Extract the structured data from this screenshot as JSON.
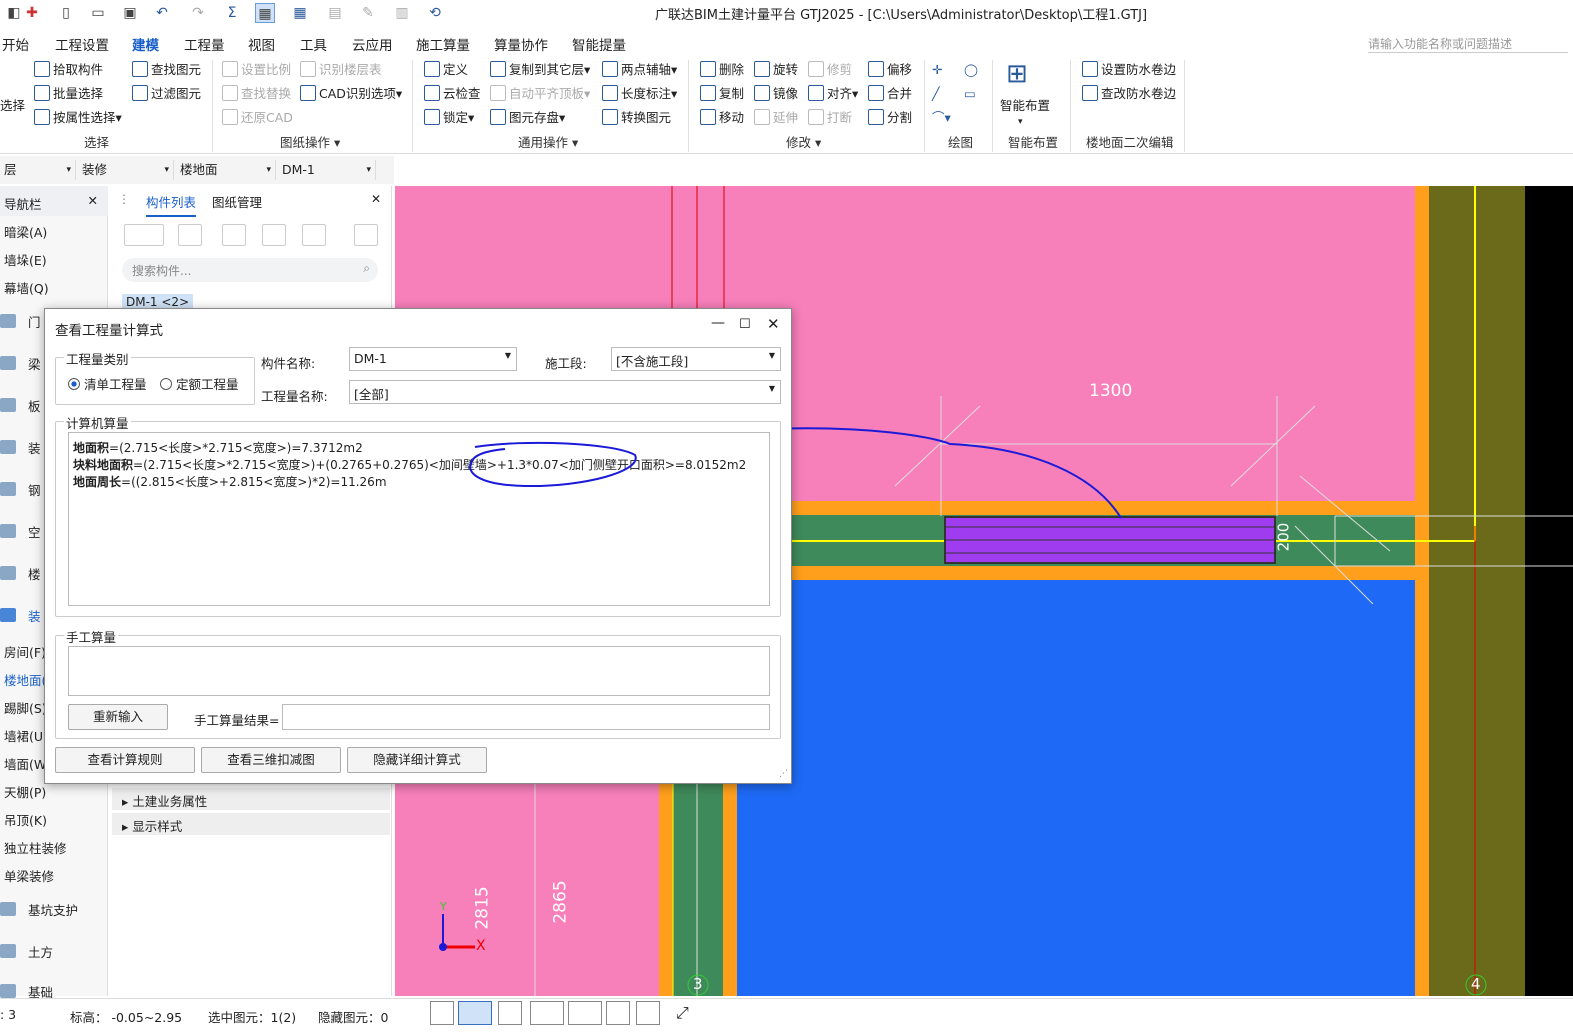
{
  "app": {
    "title": "广联达BIM土建计量平台 GTJ2025 - [C:\\Users\\Administrator\\Desktop\\工程1.GTJ]"
  },
  "menu": [
    "开始",
    "工程设置",
    "建模",
    "工程量",
    "视图",
    "工具",
    "云应用",
    "施工算量",
    "算量协作",
    "智能提量"
  ],
  "search_placeholder": "请输入功能名称或问题描述",
  "ribbon": {
    "select": {
      "pick": "拾取构件",
      "batch": "批量选择",
      "by_attr": "按属性选择",
      "find": "查找图元",
      "filter": "过滤图元",
      "group": "选择",
      "left": "选择"
    },
    "drawing": {
      "scale": "设置比例",
      "floors": "识别楼层表",
      "replace": "查找替换",
      "cad_opts": "CAD识别选项",
      "restore": "还原CAD",
      "group": "图纸操作"
    },
    "general": {
      "define": "定义",
      "copy_floor": "复制到其它层",
      "two_axis": "两点辅轴",
      "cloud_check": "云检查",
      "auto_level": "自动平齐顶板",
      "dim": "长度标注",
      "lock": "锁定",
      "save_elem": "图元存盘",
      "convert": "转换图元",
      "group": "通用操作"
    },
    "modify": {
      "delete": "删除",
      "rotate": "旋转",
      "trim": "修剪",
      "offset": "偏移",
      "copy": "复制",
      "mirror": "镜像",
      "align": "对齐",
      "merge": "合并",
      "move": "移动",
      "extend": "延伸",
      "break": "打断",
      "split": "分割",
      "group": "修改"
    },
    "draw": {
      "group": "绘图"
    },
    "smart": {
      "label": "智能布置",
      "group": "智能布置"
    },
    "floor_edit": {
      "set": "设置防水卷边",
      "check": "查改防水卷边",
      "group": "楼地面二次编辑"
    }
  },
  "selectors": {
    "floor": "层",
    "category": "装修",
    "type": "楼地面",
    "component": "DM-1"
  },
  "nav": {
    "title": "导航栏",
    "items": [
      "暗梁(A)",
      "墙垛(E)",
      "幕墙(Q)",
      "门",
      "梁",
      "板",
      "装",
      "钢",
      "空",
      "楼",
      "装",
      "房间(F)",
      "楼地面(",
      "踢脚(S)",
      "墙裙(U)",
      "墙面(W",
      "天棚(P)",
      "吊顶(K)",
      "独立柱装修",
      "单梁装修",
      "基坑支护",
      "土方",
      "基础"
    ]
  },
  "comp_panel": {
    "tabs": [
      "构件列表",
      "图纸管理"
    ],
    "search_placeholder": "搜索构件...",
    "item": "DM-1 <2>",
    "props": [
      "土建业务属性",
      "显示样式"
    ]
  },
  "dialog": {
    "title": "查看工程量计算式",
    "type_group": "工程量类别",
    "opt_list": "清单工程量",
    "opt_quota": "定额工程量",
    "comp_label": "构件名称:",
    "comp_value": "DM-1",
    "stage_label": "施工段:",
    "stage_value": "[不含施工段]",
    "qty_label": "工程量名称:",
    "qty_value": "[全部]",
    "computer_group": "计算机算量",
    "formulas": [
      {
        "name": "地面积",
        "expr": "=(2.715<长度>*2.715<宽度>)=7.3712m2"
      },
      {
        "name": "块料地面积",
        "expr": "=(2.715<长度>*2.715<宽度>)+(0.2765+0.2765)<加间壁墙>+1.3*0.07<加门侧壁开口面积>=8.0152m2"
      },
      {
        "name": "地面周长",
        "expr": "=((2.815<长度>+2.815<宽度>)*2)=11.26m"
      }
    ],
    "manual_group": "手工算量",
    "reinput": "重新输入",
    "manual_result_label": "手工算量结果=",
    "btn_rules": "查看计算规则",
    "btn_3d": "查看三维扣减图",
    "btn_hide": "隐藏详细计算式"
  },
  "canvas": {
    "dim_1300": "1300",
    "dim_200": "200",
    "dim_2815": "2815",
    "dim_2865": "2865",
    "axis_3": "3",
    "axis_4": "4",
    "axis_x": "X",
    "axis_y": "Y"
  },
  "status": {
    "count": ": 3",
    "elev": "标高： -0.05~2.95",
    "selected": "选中图元：1(2)",
    "hidden": "隐藏图元：0"
  }
}
